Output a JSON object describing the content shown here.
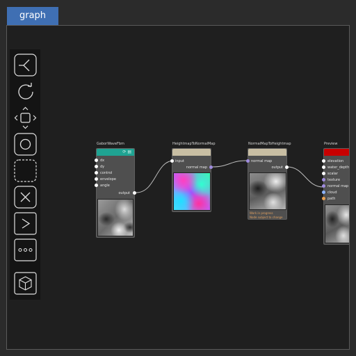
{
  "tab": {
    "label": "graph"
  },
  "toolbar": {
    "tools": [
      {
        "name": "link-tool-icon"
      },
      {
        "name": "rotate-icon"
      },
      {
        "name": "move-icon"
      },
      {
        "name": "circle-select-icon"
      },
      {
        "name": "rect-select-icon"
      },
      {
        "name": "delete-icon"
      },
      {
        "name": "run-icon"
      },
      {
        "name": "more-icon"
      },
      {
        "name": "3d-view-icon"
      }
    ]
  },
  "nodes": {
    "gabor": {
      "title": "GaborWaveFbm",
      "header_color": "#1fa392",
      "inputs": [
        "dx",
        "dy",
        "control",
        "envelope",
        "angle"
      ],
      "output": "output"
    },
    "h2n": {
      "title": "HeightmapToNormalMap",
      "header_color": "#c8bea3",
      "inputs": [
        "input"
      ],
      "output": "normal map"
    },
    "n2h": {
      "title": "NormalMapToHeightmap",
      "header_color": "#c8bea3",
      "inputs": [
        "normal map"
      ],
      "output": "output",
      "messages": [
        "Work in progress",
        "Node subject to change"
      ]
    },
    "preview": {
      "title": "Preview",
      "header_color": "#c80000",
      "inputs": [
        "elevation",
        "water_depth",
        "scalar",
        "texture",
        "normal map",
        "cloud",
        "path"
      ]
    }
  },
  "colors": {
    "tab": "#3f6fb3",
    "port_default": "#ffffff",
    "port_vector": "#a08ce0",
    "port_path": "#e8a050",
    "port_cloud": "#8cb4ff"
  }
}
